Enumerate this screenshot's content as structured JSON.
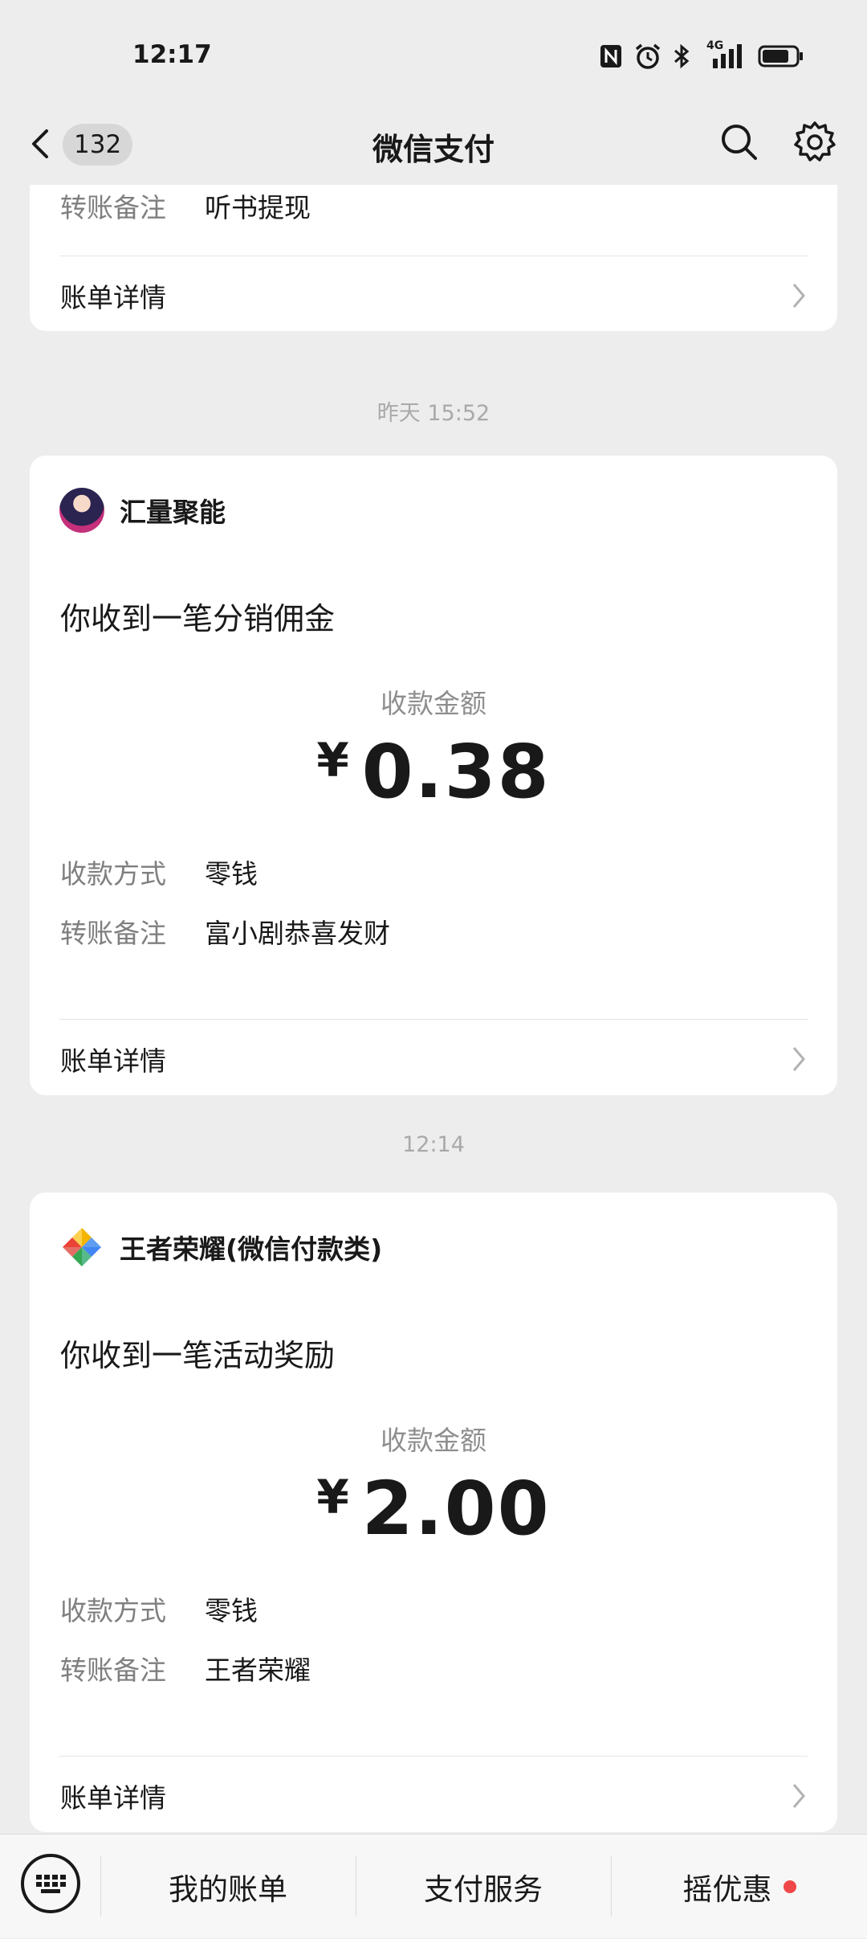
{
  "status_bar": {
    "time": "12:17",
    "network": "4G"
  },
  "nav": {
    "badge_count": "132",
    "title": "微信支付"
  },
  "labels": {
    "amount_label": "收款金额",
    "method_label": "收款方式",
    "note_label": "转账备注",
    "bill_details": "账单详情",
    "currency": "¥"
  },
  "top_card": {
    "note_value": "听书提现"
  },
  "messages": [
    {
      "timestamp": "昨天 15:52",
      "merchant": "汇量聚能",
      "title": "你收到一笔分销佣金",
      "amount": "0.38",
      "method_value": "零钱",
      "note_value": "富小剧恭喜发财"
    },
    {
      "timestamp": "12:14",
      "merchant": "王者荣耀(微信付款类)",
      "title": "你收到一笔活动奖励",
      "amount": "2.00",
      "method_value": "零钱",
      "note_value": "王者荣耀"
    }
  ],
  "bottom_bar": {
    "tab1": "我的账单",
    "tab2": "支付服务",
    "tab3": "摇优惠"
  }
}
